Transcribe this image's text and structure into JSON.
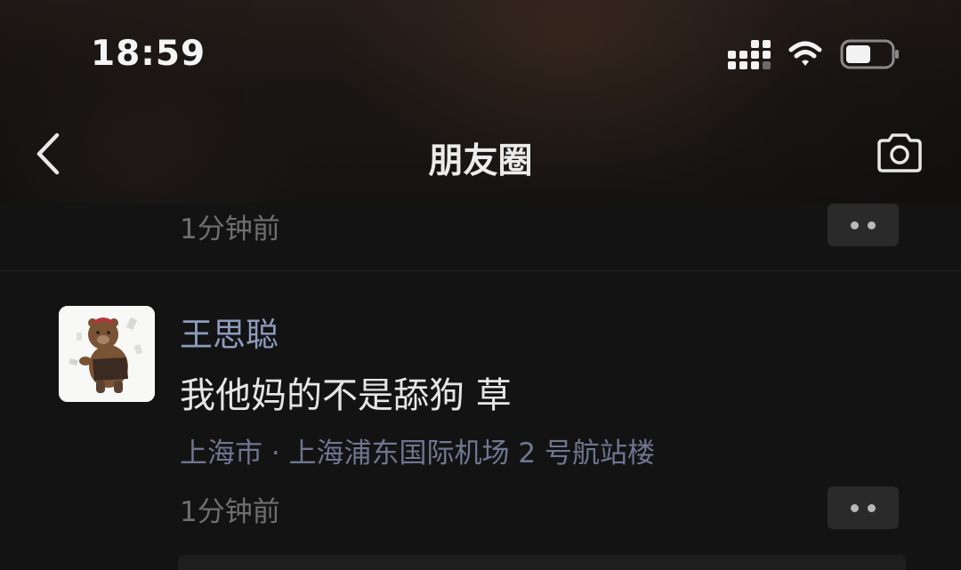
{
  "status_bar": {
    "time": "18:59"
  },
  "nav": {
    "title": "朋友圈",
    "back_icon": "chevron-left-icon",
    "camera_icon": "camera-icon"
  },
  "previous_post": {
    "time": "1分钟前"
  },
  "post": {
    "author": "王思聪",
    "text": "我他妈的不是舔狗 草",
    "location": "上海市 · 上海浦东国际机场 2 号航站楼",
    "time": "1分钟前",
    "avatar_icon": "bear-sticker-avatar"
  },
  "colors": {
    "background": "#131313",
    "author_name": "#8c9bbd",
    "location": "#6f7690",
    "timestamp": "#6f6f6f",
    "more_button_bg": "#2a2a2a"
  }
}
